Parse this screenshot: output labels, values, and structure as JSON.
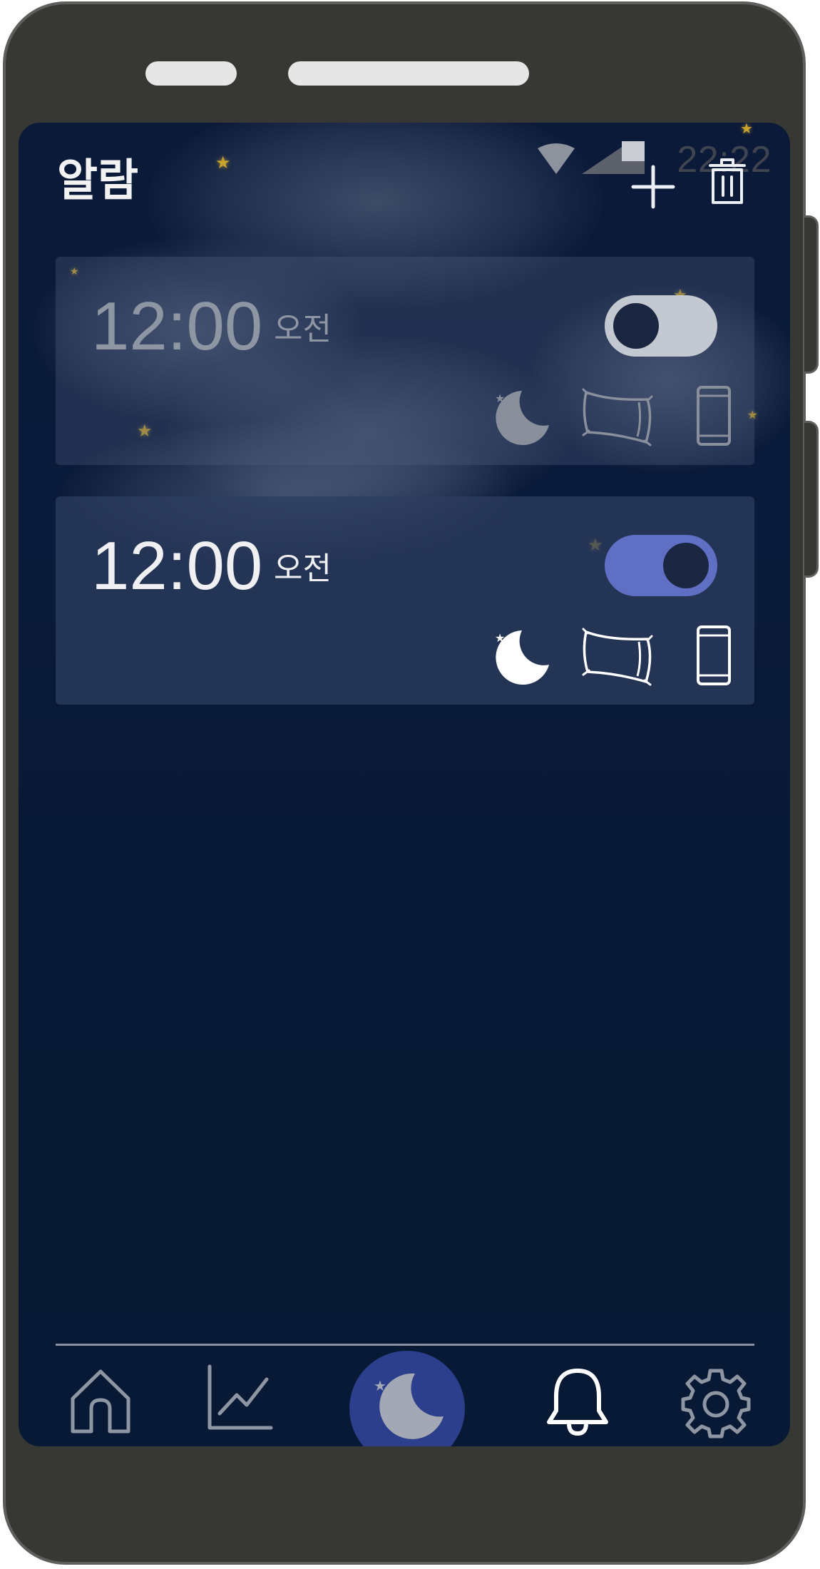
{
  "status_bar": {
    "time": "22:22",
    "icons": [
      "wifi-icon",
      "cellular-signal-icon",
      "battery-icon"
    ]
  },
  "header": {
    "title": "알람",
    "actions": [
      "add-icon",
      "delete-icon"
    ]
  },
  "alarms": [
    {
      "time": "12:00",
      "ampm": "오전",
      "enabled": false,
      "icons": [
        "moon-stars-icon",
        "pillow-icon",
        "smartphone-icon"
      ]
    },
    {
      "time": "12:00",
      "ampm": "오전",
      "enabled": true,
      "icons": [
        "moon-stars-icon",
        "pillow-icon",
        "smartphone-icon"
      ]
    }
  ],
  "bottom_nav": {
    "items": [
      "home-icon",
      "chart-icon",
      "sleep-moon-icon",
      "alarm-bell-icon",
      "settings-gear-icon"
    ],
    "active": "alarm-bell-icon"
  },
  "colors": {
    "background": "#071934",
    "toggle_on": "#5f6fc4",
    "toggle_off": "#c4c8d1",
    "center_button": "#2b3f8c",
    "star": "#c9a32a"
  }
}
